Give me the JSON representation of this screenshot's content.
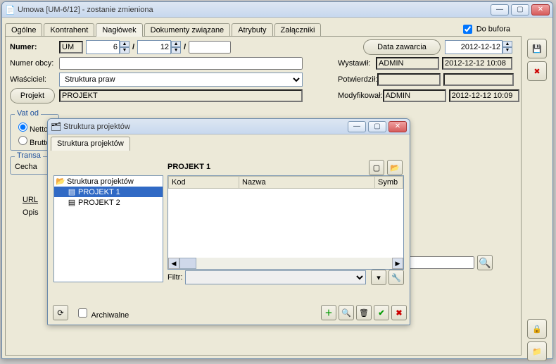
{
  "mainWindow": {
    "title": "Umowa [UM-6/12] - zostanie zmieniona",
    "tabs": [
      "Ogólne",
      "Kontrahent",
      "Nagłówek",
      "Dokumenty związane",
      "Atrybuty",
      "Załączniki"
    ],
    "activeTab": 2,
    "doBufora": {
      "label": "Do bufora",
      "checked": true
    },
    "numer": {
      "label": "Numer:",
      "prefix": "UM",
      "n1": "6",
      "n2": "12"
    },
    "numerObcy": {
      "label": "Numer obcy:",
      "value": ""
    },
    "wlasciciel": {
      "label": "Właściciel:",
      "value": "Struktura praw"
    },
    "projekt": {
      "button": "Projekt",
      "value": "PROJEKT"
    },
    "dataZawarcia": {
      "button": "Data zawarcia",
      "value": "2012-12-12"
    },
    "wystawil": {
      "label": "Wystawił:",
      "value": "ADMIN",
      "ts": "2012-12-12 10:08"
    },
    "potwierdzil": {
      "label": "Potwierdził:",
      "value": "",
      "ts": ""
    },
    "modyfikowal": {
      "label": "Modyfikował:",
      "value": "ADMIN",
      "ts": "2012-12-12 10:09"
    },
    "vat": {
      "legend": "Vat od",
      "opt1": "Netto",
      "opt2": "Brutto"
    },
    "transa": {
      "legend": "Transa",
      "cecha": "Cecha"
    },
    "url": "URL",
    "opis": "Opis"
  },
  "projWindow": {
    "title": " Struktura projektów",
    "tab": "Struktura projektów",
    "heading": "PROJEKT 1",
    "tree": [
      {
        "label": "Struktura projektów",
        "icon": "📂",
        "indent": 0,
        "sel": false
      },
      {
        "label": "PROJEKT 1",
        "icon": "▤",
        "indent": 1,
        "sel": true
      },
      {
        "label": "PROJEKT 2",
        "icon": "▤",
        "indent": 1,
        "sel": false
      }
    ],
    "columns": [
      "Kod",
      "Nazwa",
      "Symb"
    ],
    "filterLabel": "Filtr:",
    "archiwalne": "Archiwalne"
  }
}
